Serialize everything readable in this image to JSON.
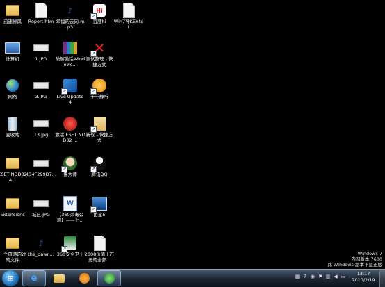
{
  "desktop": {
    "icons": [
      {
        "label": "迅速修风",
        "icon": "folder-icon",
        "shortcut": false
      },
      {
        "label": "Report.htm",
        "icon": "html-document-icon",
        "shortcut": false
      },
      {
        "label": "幸福的去向.mp3",
        "icon": "mp3-file-icon",
        "shortcut": false
      },
      {
        "label": "百度hi",
        "icon": "baidu-hi-icon",
        "shortcut": true
      },
      {
        "label": "Win7神KEY.txt",
        "icon": "text-file-icon",
        "shortcut": false
      },
      {
        "label": "计算机",
        "icon": "computer-icon",
        "shortcut": false
      },
      {
        "label": "1.JPG",
        "icon": "image-file-icon",
        "shortcut": false
      },
      {
        "label": "破解激活Windows...",
        "icon": "winrar-archive-icon",
        "shortcut": false
      },
      {
        "label": "测试整理 - 快捷方式",
        "icon": "red-x-tool-icon",
        "shortcut": true
      },
      {
        "label": "网络",
        "icon": "network-globe-icon",
        "shortcut": false
      },
      {
        "label": "3.JPG",
        "icon": "image-file-icon",
        "shortcut": false
      },
      {
        "label": "Live Update 4",
        "icon": "live-update-icon",
        "shortcut": true
      },
      {
        "label": "千千静听",
        "icon": "ttplayer-icon",
        "shortcut": true
      },
      {
        "label": "回收站",
        "icon": "recycle-bin-icon",
        "shortcut": false
      },
      {
        "label": "13.jpg",
        "icon": "image-file-icon",
        "shortcut": false
      },
      {
        "label": "激活 ESET NOD32 ...",
        "icon": "eset-icon",
        "shortcut": false
      },
      {
        "label": "新软 - 快捷方式",
        "icon": "folder-shortcut-icon",
        "shortcut": true
      },
      {
        "label": "ESET NOD32 A...",
        "icon": "folder-icon",
        "shortcut": false
      },
      {
        "label": "434F299D7...",
        "icon": "image-file-icon",
        "shortcut": false
      },
      {
        "label": "鲁大师",
        "icon": "ludashi-icon",
        "shortcut": true
      },
      {
        "label": "腾讯QQ",
        "icon": "qq-penguin-icon",
        "shortcut": true
      },
      {
        "label": "Extensions",
        "icon": "folder-icon",
        "shortcut": false
      },
      {
        "label": "城区.JPG",
        "icon": "image-file-icon",
        "shortcut": false
      },
      {
        "label": "【360杀毒公测】——七...",
        "icon": "word-document-icon",
        "shortcut": false
      },
      {
        "label": "由星5",
        "icon": "screenshot-tool-icon",
        "shortcut": true
      },
      {
        "label": "一个旅游的过的文件",
        "icon": "folder-icon",
        "shortcut": false
      },
      {
        "label": "the_dawn...",
        "icon": "mp3-file-icon",
        "shortcut": false
      },
      {
        "label": "360安全卫士",
        "icon": "360-safe-guard-icon",
        "shortcut": true
      },
      {
        "label": "2008价值上万元的全部...",
        "icon": "text-file-icon",
        "shortcut": false
      }
    ]
  },
  "watermark": {
    "line1": "Windows 7",
    "line2": "内部版本 7600",
    "line3": "此 Windows 副本不是正版"
  },
  "taskbar": {
    "start_icon": "windows-start-orb-icon",
    "buttons": [
      {
        "name": "internet-explorer",
        "icon": "internet-explorer-icon",
        "active": true
      },
      {
        "name": "windows-explorer",
        "icon": "folder-explorer-icon",
        "active": false
      },
      {
        "name": "media-player",
        "icon": "media-player-icon",
        "active": false
      },
      {
        "name": "360-browser",
        "icon": "360-browser-icon",
        "active": true
      }
    ],
    "tray_icons": [
      "language-icon",
      "help-icon",
      "security-icon",
      "flag-icon",
      "network-icon",
      "volume-icon",
      "battery-icon"
    ],
    "clock": {
      "time": "13:17",
      "date": "2010/2/19"
    }
  }
}
